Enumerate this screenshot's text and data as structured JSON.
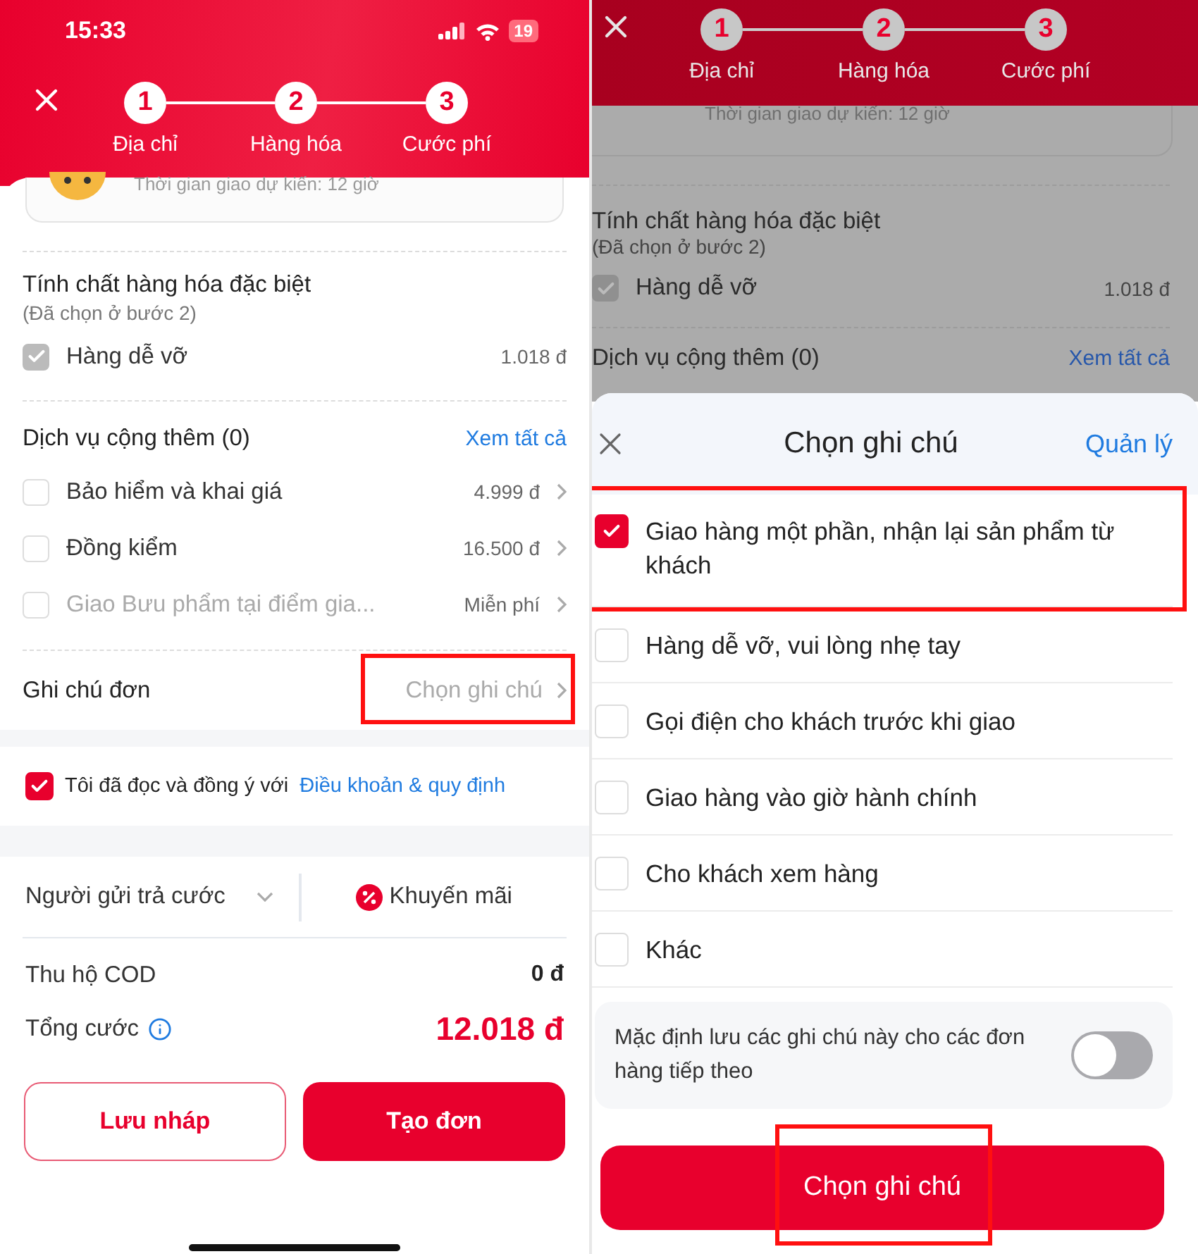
{
  "left_screen": {
    "status_bar": {
      "time": "15:33",
      "battery": "19"
    },
    "steps": [
      {
        "number": "1",
        "label": "Địa chỉ"
      },
      {
        "number": "2",
        "label": "Hàng hóa"
      },
      {
        "number": "3",
        "label": "Cước phí"
      }
    ],
    "delivery_card": {
      "text": "Thời gian giao dự kiến: 12 giờ"
    },
    "special_goods": {
      "title": "Tính chất hàng hóa đặc biệt",
      "subtitle": "(Đã chọn ở bước 2)",
      "items": [
        {
          "label": "Hàng dễ vỡ",
          "price": "1.018 đ",
          "checked": true,
          "disabled": true
        }
      ]
    },
    "extra_services": {
      "title": "Dịch vụ cộng thêm (0)",
      "link": "Xem tất cả",
      "items": [
        {
          "label": "Bảo hiểm và khai giá",
          "price": "4.999 đ",
          "checked": false,
          "disabled": false
        },
        {
          "label": "Đồng kiểm",
          "price": "16.500 đ",
          "checked": false,
          "disabled": false
        },
        {
          "label": "Giao Bưu phẩm tại điểm gia...",
          "price": "Miễn phí",
          "checked": false,
          "disabled": true
        }
      ]
    },
    "order_note": {
      "label": "Ghi chú đơn",
      "hint": "Chọn ghi chú",
      "highlighted": true
    },
    "terms": {
      "checked": true,
      "text": "Tôi đã đọc và đồng ý với",
      "link": "Điều khoản & quy định"
    },
    "payer": {
      "value": "Người gửi trả cước"
    },
    "promo": {
      "label": "Khuyến mãi"
    },
    "summary": [
      {
        "label": "Thu hộ COD",
        "value": "0 đ",
        "kind": "plain"
      },
      {
        "label": "Tổng cước",
        "value": "12.018 đ",
        "kind": "total"
      }
    ],
    "buttons": [
      {
        "label": "Lưu nháp",
        "kind": "outline"
      },
      {
        "label": "Tạo đơn",
        "kind": "primary"
      }
    ]
  },
  "right_screen": {
    "steps": [
      {
        "number": "1",
        "label": "Địa chỉ"
      },
      {
        "number": "2",
        "label": "Hàng hóa"
      },
      {
        "number": "3",
        "label": "Cước phí"
      }
    ],
    "background": {
      "delivery_text": "Thời gian giao dự kiến: 12 giờ",
      "special_title": "Tính chất hàng hóa đặc biệt",
      "special_subtitle": "(Đã chọn ở bước 2)",
      "item_label": "Hàng dễ vỡ",
      "item_checked": true,
      "item_price": "1.018 đ",
      "services_title": "Dịch vụ cộng thêm (0)",
      "services_link": "Xem tất cả"
    },
    "sheet": {
      "title": "Chọn ghi chú",
      "action": "Quản lý",
      "options": [
        {
          "label": "Giao hàng một phần, nhận lại sản phẩm từ khách",
          "checked": true,
          "highlighted": true
        },
        {
          "label": "Hàng dễ vỡ, vui lòng nhẹ tay",
          "checked": false,
          "highlighted": false
        },
        {
          "label": "Gọi điện cho khách trước khi giao",
          "checked": false,
          "highlighted": false
        },
        {
          "label": "Giao hàng vào giờ hành chính",
          "checked": false,
          "highlighted": false
        },
        {
          "label": "Cho khách xem hàng",
          "checked": false,
          "highlighted": false
        },
        {
          "label": "Khác",
          "checked": false,
          "highlighted": false
        }
      ],
      "default_toggle": {
        "text": "Mặc định lưu các ghi chú này cho các đơn hàng tiếp theo",
        "on": false
      },
      "button": {
        "label": "Chọn ghi chú",
        "highlighted": true
      }
    }
  }
}
